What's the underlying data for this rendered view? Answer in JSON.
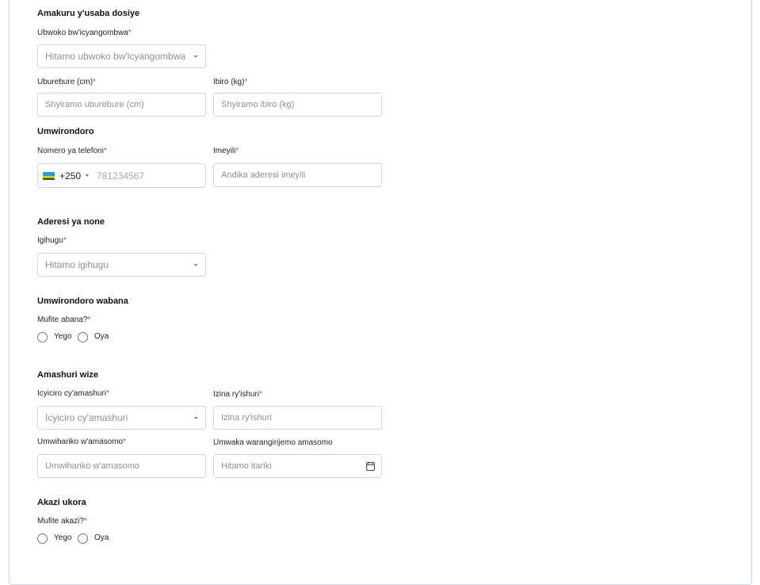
{
  "profile_info": {
    "title": "Amakuru y'usaba dosiye",
    "job_type": {
      "label": "Ubwoko bw'icyangombwa",
      "placeholder": "Hitamo ubwoko bw'icyangombwa"
    },
    "height": {
      "label": "Uburebure (cm)",
      "placeholder": "Shyiramo uburebure (cm)"
    },
    "weight": {
      "label": "Ibiro (kg)",
      "placeholder": "Shyiramo ibiro (kg)"
    }
  },
  "contact": {
    "title": "Umwirondoro",
    "phone": {
      "label": "Nomero ya telefoni",
      "prefix": "+250",
      "placeholder": "781234567",
      "flag": "rwanda-flag-icon"
    },
    "email": {
      "label": "Imeyili",
      "placeholder": "Andika aderesi imeyili"
    }
  },
  "address": {
    "title": "Aderesi ya none",
    "country": {
      "label": "Igihugu",
      "placeholder": "Hitamo igihugu"
    }
  },
  "children": {
    "title": "Umwirondoro wabana",
    "question": "Mufite abana?",
    "yes": "Yego",
    "no": "Oya"
  },
  "education": {
    "title": "Amashuri wize",
    "level": {
      "label": "Icyiciro cy'amashuri",
      "placeholder": "Icyiciro cy'amashuri"
    },
    "school": {
      "label": "Izina ry'ishuri",
      "placeholder": "Izina ry'ishuri"
    },
    "field": {
      "label": "Umwihariko w'amasomo",
      "placeholder": "Umwihariko w'amasomo"
    },
    "year": {
      "label": "Umwaka warangirijemo amasomo",
      "placeholder": "Hitamo itariki",
      "icon": "calendar-icon"
    }
  },
  "work": {
    "title": "Akazi ukora",
    "question": "Mufite akazi?",
    "yes": "Yego",
    "no": "Oya"
  },
  "required_mark": "*",
  "colors": {
    "required": "#d9363e",
    "border": "#d2d6dc",
    "flag_blue": "#20a0e0",
    "flag_yellow": "#fad201",
    "flag_green": "#20603d"
  }
}
